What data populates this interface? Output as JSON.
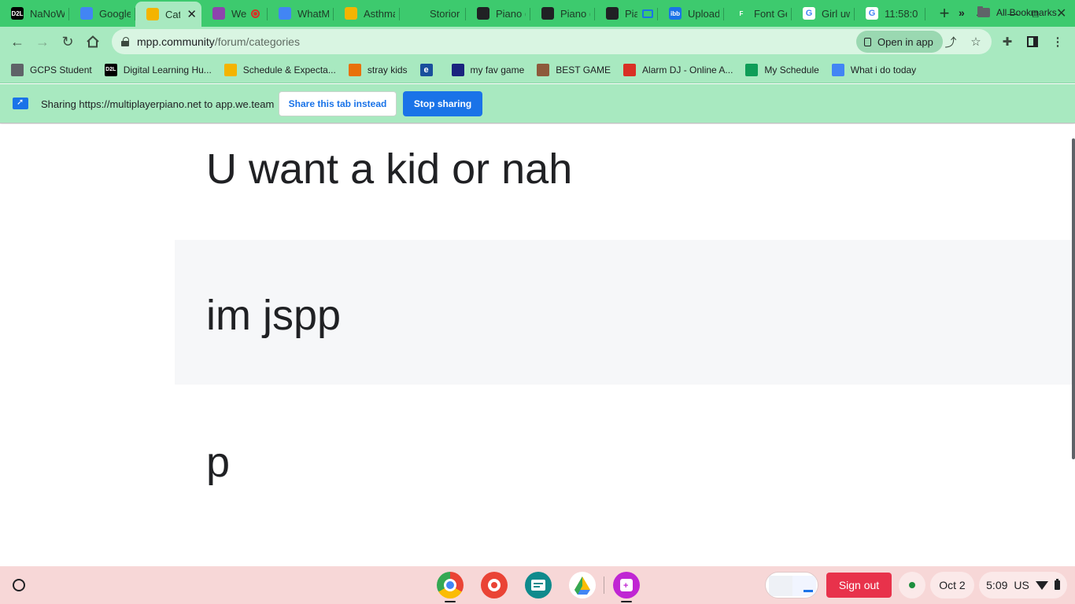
{
  "tabs": [
    {
      "title": "NaNoW",
      "favicon": "d2l-icon",
      "color": "#000000",
      "glyph": "D2L"
    },
    {
      "title": "Google",
      "favicon": "google-docs-icon",
      "color": "#4285f4",
      "glyph": ""
    },
    {
      "title": "Cat",
      "favicon": "pencil-icon",
      "color": "#f4b400",
      "glyph": "",
      "active": true
    },
    {
      "title": "We",
      "favicon": "weteam-icon",
      "color": "#8e44ad",
      "glyph": "",
      "recording": true
    },
    {
      "title": "WhatM",
      "favicon": "google-docs-icon",
      "color": "#4285f4",
      "glyph": ""
    },
    {
      "title": "Asthma",
      "favicon": "google-slides-icon",
      "color": "#f4b400",
      "glyph": ""
    },
    {
      "title": "Storior",
      "favicon": "wand-icon",
      "color": "#3dca6e",
      "glyph": ""
    },
    {
      "title": "Piano (",
      "favicon": "piano-icon",
      "color": "#202124",
      "glyph": ""
    },
    {
      "title": "Piano (",
      "favicon": "piano-icon",
      "color": "#202124",
      "glyph": ""
    },
    {
      "title": "Pia",
      "favicon": "piano-icon",
      "color": "#202124",
      "glyph": "",
      "screen": true
    },
    {
      "title": "Upload",
      "favicon": "ibb-icon",
      "color": "#1a73e8",
      "glyph": "ibb"
    },
    {
      "title": "Font Ge",
      "favicon": "fontgen-icon",
      "color": "#3dca6e",
      "glyph": "F"
    },
    {
      "title": "Girl uwu",
      "favicon": "google-g-icon",
      "color": "#ffffff",
      "glyph": "G"
    },
    {
      "title": "11:58:0",
      "favicon": "google-g-icon",
      "color": "#ffffff",
      "glyph": "G"
    }
  ],
  "toolbar": {
    "url_host": "mpp.community",
    "url_path": "/forum/categories",
    "open_in_app": "Open in app"
  },
  "bookmarks": [
    {
      "label": "GCPS Student",
      "icon": "building-icon",
      "color": "#5f6368",
      "glyph": ""
    },
    {
      "label": "Digital Learning Hu...",
      "icon": "d2l-icon",
      "color": "#000000",
      "glyph": "D2L"
    },
    {
      "label": "Schedule & Expecta...",
      "icon": "google-slides-icon",
      "color": "#f4b400",
      "glyph": ""
    },
    {
      "label": "stray kids",
      "icon": "swirl-icon",
      "color": "#e8710a",
      "glyph": ""
    },
    {
      "label": "",
      "icon": "edge-icon",
      "color": "#1a4f9c",
      "glyph": "e"
    },
    {
      "label": "my fav game",
      "icon": "game-icon",
      "color": "#1a237e",
      "glyph": ""
    },
    {
      "label": "BEST GAME",
      "icon": "face-icon",
      "color": "#8d5a3b",
      "glyph": ""
    },
    {
      "label": "Alarm DJ - Online A...",
      "icon": "alarm-icon",
      "color": "#d93025",
      "glyph": ""
    },
    {
      "label": "My Schedule",
      "icon": "google-sheets-icon",
      "color": "#0f9d58",
      "glyph": ""
    },
    {
      "label": "What i do today",
      "icon": "google-docs-icon",
      "color": "#4285f4",
      "glyph": ""
    }
  ],
  "bookmarks_all": "All Bookmarks",
  "sharing": {
    "text": "Sharing https://multiplayerpiano.net to app.we.team",
    "share_this_tab": "Share this tab instead",
    "stop_sharing": "Stop sharing"
  },
  "content": {
    "rows": [
      "U want a kid or nah",
      "im jspp",
      "p"
    ]
  },
  "shelf": {
    "sign_out": "Sign out",
    "date": "Oct 2",
    "time": "5:09",
    "locale": "US"
  }
}
